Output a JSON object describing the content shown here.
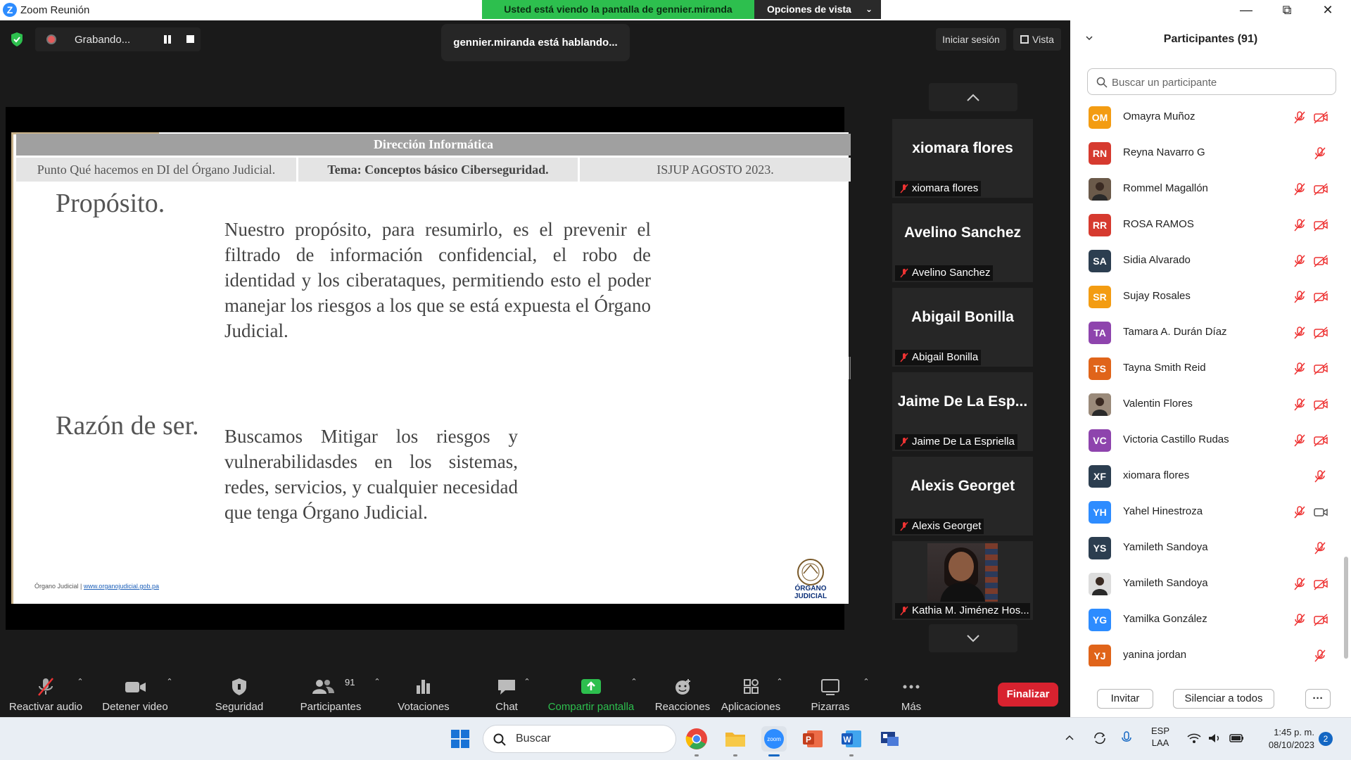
{
  "window": {
    "title": "Zoom Reunión",
    "share_banner": "Usted está viendo la pantalla de gennier.miranda",
    "view_options": "Opciones de vista"
  },
  "meeting": {
    "recording_label": "Grabando...",
    "speaking": "gennier.miranda está hablando...",
    "signin": "Iniciar sesión",
    "view": "Vista"
  },
  "slide": {
    "header": "Dirección Informática",
    "sub_left": "Punto Qué hacemos en DI del Órgano Judicial.",
    "sub_center": "Tema: Conceptos básico Ciberseguridad.",
    "sub_right": "ISJUP AGOSTO 2023.",
    "section1_title": "Propósito.",
    "section1_text": "Nuestro propósito, para resumirlo, es el prevenir el filtrado de información confidencial, el robo de identidad y los ciberataques, permitiendo esto el poder manejar los riesgos a los que se está expuesta el Órgano Judicial.",
    "section2_title": "Razón de ser.",
    "section2_text": "Buscamos Mitigar los riesgos y vulnerabilidasdes en los sistemas, redes, servicios, y cualquier necesidad que tenga Órgano Judicial.",
    "footer_org": "Órgano Judicial",
    "footer_link": "www.organojudicial.gob.pa",
    "logo_text_1": "ÓRGANO",
    "logo_text_2": "JUDICIAL"
  },
  "tiles": [
    {
      "big": "xiomara flores",
      "small": "xiomara flores"
    },
    {
      "big": "Avelino Sanchez",
      "small": "Avelino Sanchez"
    },
    {
      "big": "Abigail Bonilla",
      "small": "Abigail Bonilla"
    },
    {
      "big": "Jaime De La Esp...",
      "small": "Jaime De La Espriella"
    },
    {
      "big": "Alexis Georget",
      "small": "Alexis Georget"
    },
    {
      "big": "",
      "small": "Kathia M. Jiménez Hos..."
    }
  ],
  "toolbar": {
    "unmute": "Reactivar audio",
    "stop_video": "Detener video",
    "security": "Seguridad",
    "participants": "Participantes",
    "participants_count": "91",
    "polls": "Votaciones",
    "chat": "Chat",
    "share": "Compartir pantalla",
    "reactions": "Reacciones",
    "apps": "Aplicaciones",
    "whiteboards": "Pizarras",
    "more": "Más",
    "end": "Finalizar"
  },
  "panel": {
    "title": "Participantes (91)",
    "search_placeholder": "Buscar un participante",
    "invite": "Invitar",
    "mute_all": "Silenciar a todos",
    "more": "···",
    "participants": [
      {
        "initials": "OM",
        "name": "Omayra Muñoz",
        "color": "#f39c12",
        "cam_off": true
      },
      {
        "initials": "RN",
        "name": "Reyna Navarro G",
        "color": "#d63a2f",
        "cam_off": false,
        "no_cam": true
      },
      {
        "initials": "",
        "name": "Rommel Magallón",
        "color": "#6b5a4a",
        "photo": true,
        "cam_off": true
      },
      {
        "initials": "RR",
        "name": "ROSA RAMOS",
        "color": "#d63a2f",
        "cam_off": true
      },
      {
        "initials": "SA",
        "name": "Sidia Alvarado",
        "color": "#2c3e50",
        "cam_off": true
      },
      {
        "initials": "SR",
        "name": "Sujay Rosales",
        "color": "#f39c12",
        "cam_off": true
      },
      {
        "initials": "TA",
        "name": "Tamara A. Durán Díaz",
        "color": "#8e44ad",
        "cam_off": true
      },
      {
        "initials": "TS",
        "name": "Tayna Smith Reid",
        "color": "#e0641a",
        "cam_off": true
      },
      {
        "initials": "",
        "name": "Valentin Flores",
        "color": "#9a8a7a",
        "photo": true,
        "cam_off": true
      },
      {
        "initials": "VC",
        "name": "Victoria Castillo Rudas",
        "color": "#8e44ad",
        "cam_off": true
      },
      {
        "initials": "XF",
        "name": "xiomara flores",
        "color": "#2c3e50",
        "cam_off": false,
        "no_cam": true
      },
      {
        "initials": "YH",
        "name": "Yahel Hinestroza",
        "color": "#2d8cff",
        "cam_off": false,
        "cam_on": true
      },
      {
        "initials": "YS",
        "name": "Yamileth Sandoya",
        "color": "#2c3e50",
        "cam_off": false,
        "no_cam": true
      },
      {
        "initials": "",
        "name": "Yamileth Sandoya",
        "color": "#dddddd",
        "photo": true,
        "cam_off": true
      },
      {
        "initials": "YG",
        "name": "Yamilka González",
        "color": "#2d8cff",
        "cam_off": true
      },
      {
        "initials": "YJ",
        "name": "yanina jordan",
        "color": "#e0641a",
        "cam_off": false,
        "no_cam": true
      }
    ]
  },
  "taskbar": {
    "search": "Buscar",
    "lang_1": "ESP",
    "lang_2": "LAA",
    "time": "1:45 p. m.",
    "date": "08/10/2023",
    "notifications": "2"
  }
}
